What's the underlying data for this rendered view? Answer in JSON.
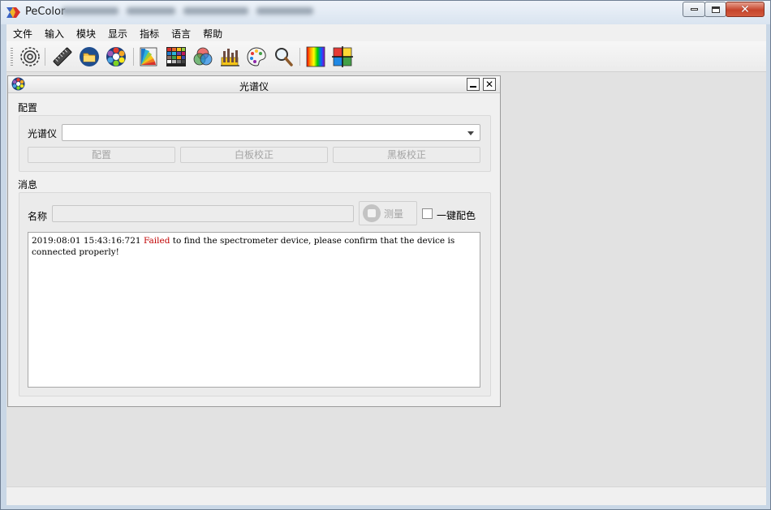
{
  "window": {
    "title": "PeColor"
  },
  "menu": [
    "文件",
    "输入",
    "模块",
    "显示",
    "指标",
    "语言",
    "帮助"
  ],
  "toolbar": {
    "icons": [
      "settings-icon",
      "ruler-icon",
      "folder-icon",
      "color-wheel-icon",
      "fan-deck-icon",
      "color-grid-icon",
      "rgb-circles-icon",
      "chart-icon",
      "palette-icon",
      "magnifier-icon",
      "spectrum-icon",
      "color-picker-icon"
    ]
  },
  "subwindow": {
    "title": "光谱仪",
    "config_label": "配置",
    "spectrometer_label": "光谱仪",
    "spectrometer_value": "",
    "buttons": {
      "configure": "配置",
      "white_calibration": "白板校正",
      "black_calibration": "黑板校正"
    },
    "message_label": "消息",
    "name_label": "名称",
    "name_value": "",
    "measure_label": "测量",
    "one_click_label": "一键配色",
    "log": {
      "timestamp": "2019:08:01 15:43:16:721",
      "status": "Failed",
      "message": "to find the spectrometer device, please confirm that the device is connected properly!"
    }
  },
  "colors": {
    "error": "#c00000",
    "close_button": "#c6452c"
  }
}
